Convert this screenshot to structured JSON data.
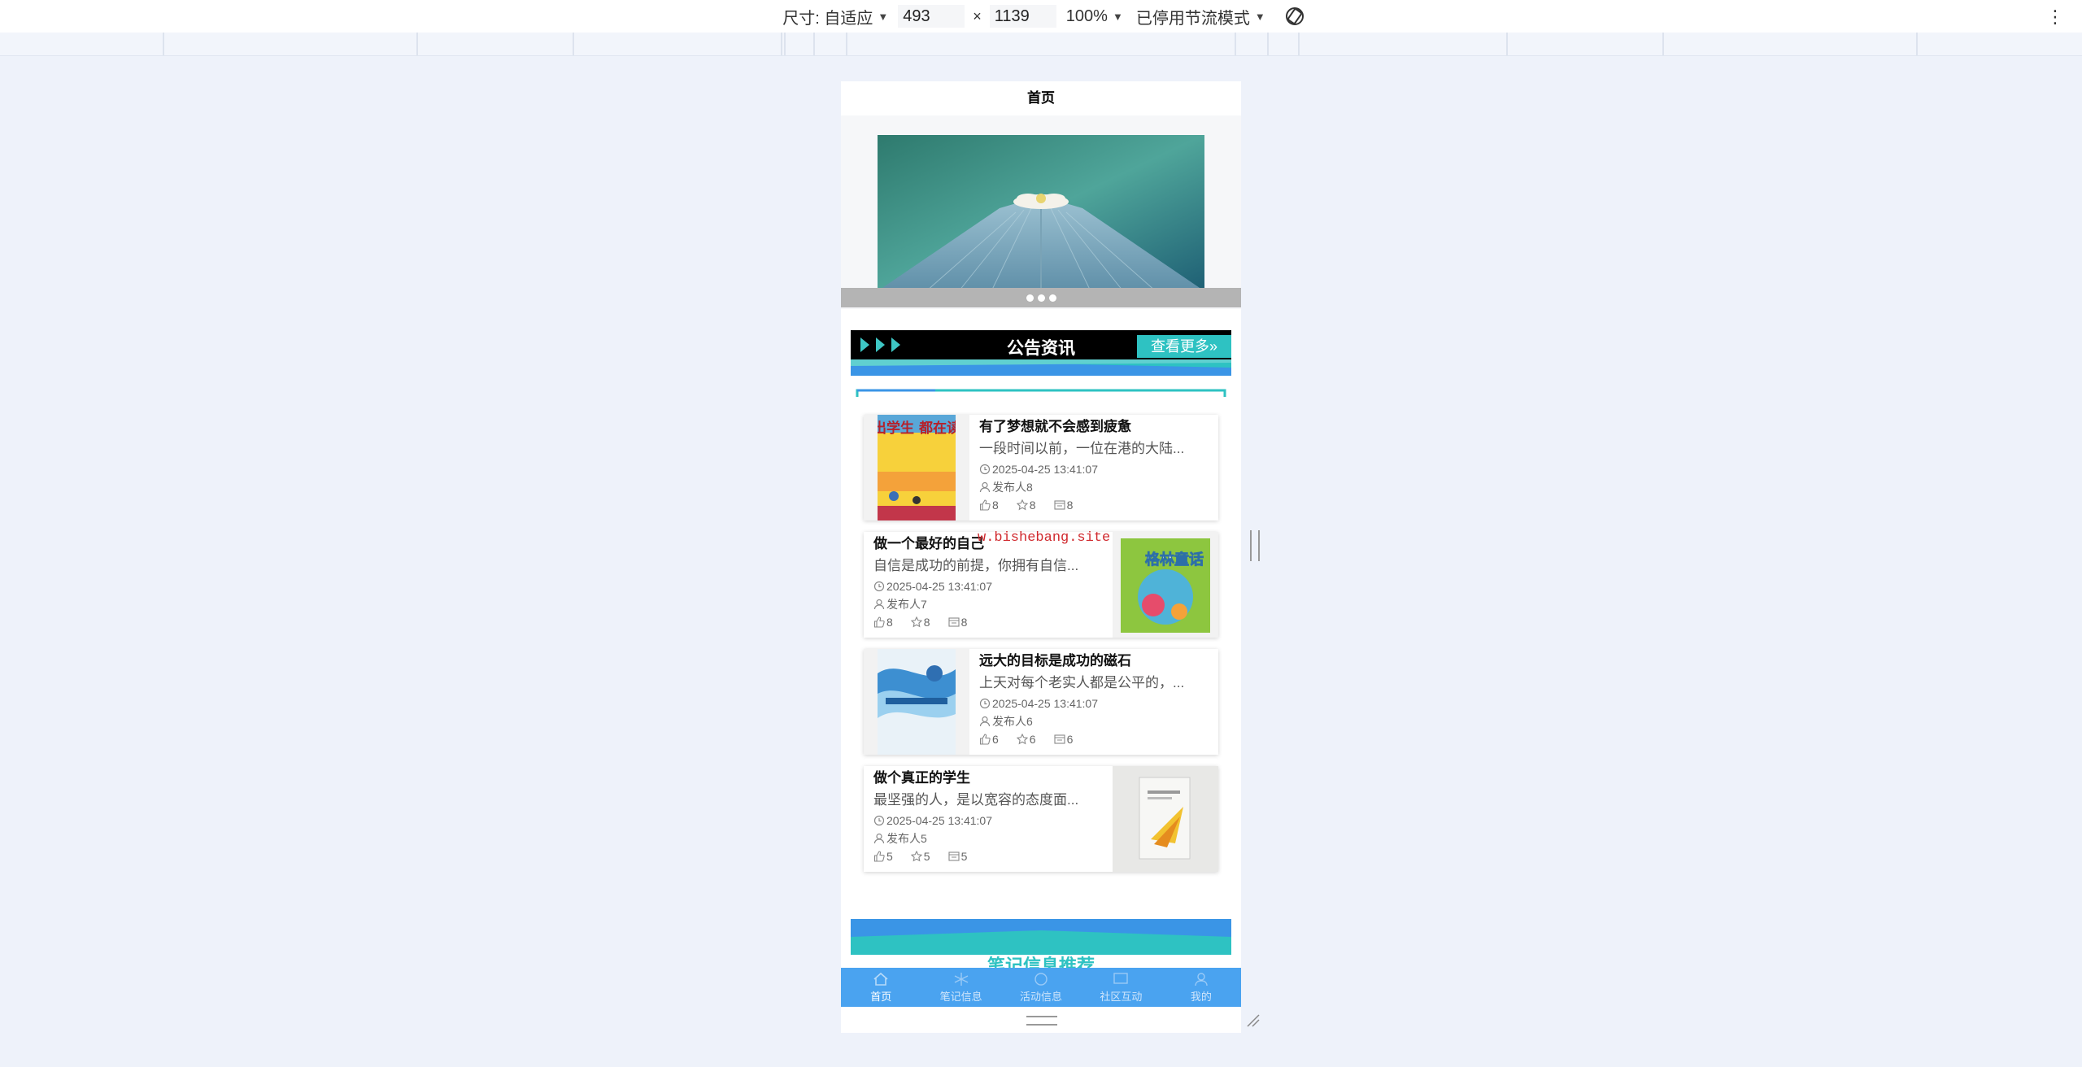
{
  "devtools": {
    "size_label": "尺寸: 自适应",
    "width_value": "493",
    "times": "×",
    "height_value": "1139",
    "zoom": "100%",
    "throttle": "已停用节流模式"
  },
  "page": {
    "title": "首页",
    "banner": {
      "dots": 3,
      "active_dot": 0
    },
    "notice": {
      "title": "公告资讯",
      "more_label": "查看更多»",
      "items": [
        {
          "title": "有了梦想就不会感到疲惫",
          "desc": "一段时间以前，一位在港的大陆...",
          "time": "2025-04-25 13:41:07",
          "publisher": "发布人8",
          "likes": "8",
          "stars": "8",
          "views": "8",
          "image_side": "left",
          "cover_text": "全世界 杰出学生 都在读的 数学书"
        },
        {
          "title": "做一个最好的自己",
          "desc": "自信是成功的前提，你拥有自信...",
          "time": "2025-04-25 13:41:07",
          "publisher": "发布人7",
          "likes": "8",
          "stars": "8",
          "views": "8",
          "image_side": "right",
          "cover_text": "格林童话"
        },
        {
          "title": "远大的目标是成功的磁石",
          "desc": "上天对每个老实人都是公平的，...",
          "time": "2025-04-25 13:41:07",
          "publisher": "发布人6",
          "likes": "6",
          "stars": "6",
          "views": "6",
          "image_side": "left",
          "cover_text": ""
        },
        {
          "title": "做个真正的学生",
          "desc": "最坚强的人，是以宽容的态度面...",
          "time": "2025-04-25 13:41:07",
          "publisher": "发布人5",
          "likes": "5",
          "stars": "5",
          "views": "5",
          "image_side": "right",
          "cover_text": ""
        }
      ]
    },
    "watermark": "w.bishebang.site",
    "section2_title": "笔记信息推荐",
    "tabs": [
      {
        "label": "首页",
        "icon": "home-icon",
        "active": true
      },
      {
        "label": "笔记信息",
        "icon": "notes-icon",
        "active": false
      },
      {
        "label": "活动信息",
        "icon": "activity-icon",
        "active": false
      },
      {
        "label": "社区互动",
        "icon": "community-icon",
        "active": false
      },
      {
        "label": "我的",
        "icon": "user-icon",
        "active": false
      }
    ]
  },
  "colors": {
    "accent": "#2ec2c2",
    "tabbar": "#4aa3f0",
    "watermark": "#d0282d"
  }
}
